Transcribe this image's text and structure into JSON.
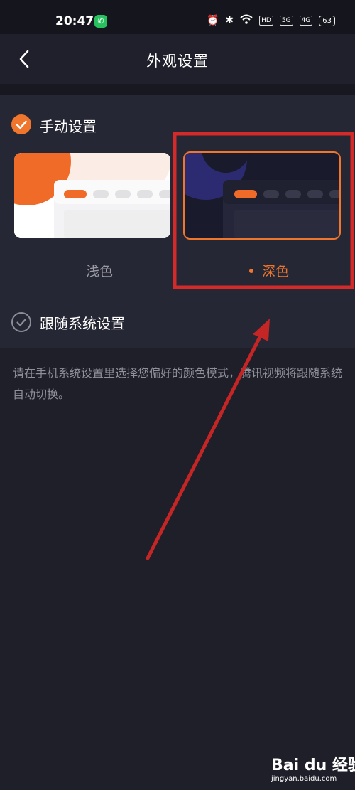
{
  "status_bar": {
    "time": "20:47",
    "app_icon": "phone-icon",
    "signal_tags": [
      "HD",
      "5G",
      "4G"
    ],
    "battery": "63"
  },
  "header": {
    "title": "外观设置",
    "back_icon": "back-arrow-icon"
  },
  "appearance": {
    "manual_label": "手动设置",
    "manual_checked": true,
    "options": [
      {
        "label": "浅色",
        "selected": false
      },
      {
        "label": "深色",
        "selected": true
      }
    ],
    "follow_label": "跟随系统设置",
    "follow_checked": false,
    "hint": "请在手机系统设置里选择您偏好的颜色模式，腾讯视频将跟随系统自动切换。"
  },
  "colors": {
    "accent": "#f0762e",
    "annotation": "#d42a2a",
    "background": "#1e1f29",
    "card": "#262734"
  },
  "watermark": {
    "main": "Bai du 经验",
    "sub": "jingyan.baidu.com"
  }
}
